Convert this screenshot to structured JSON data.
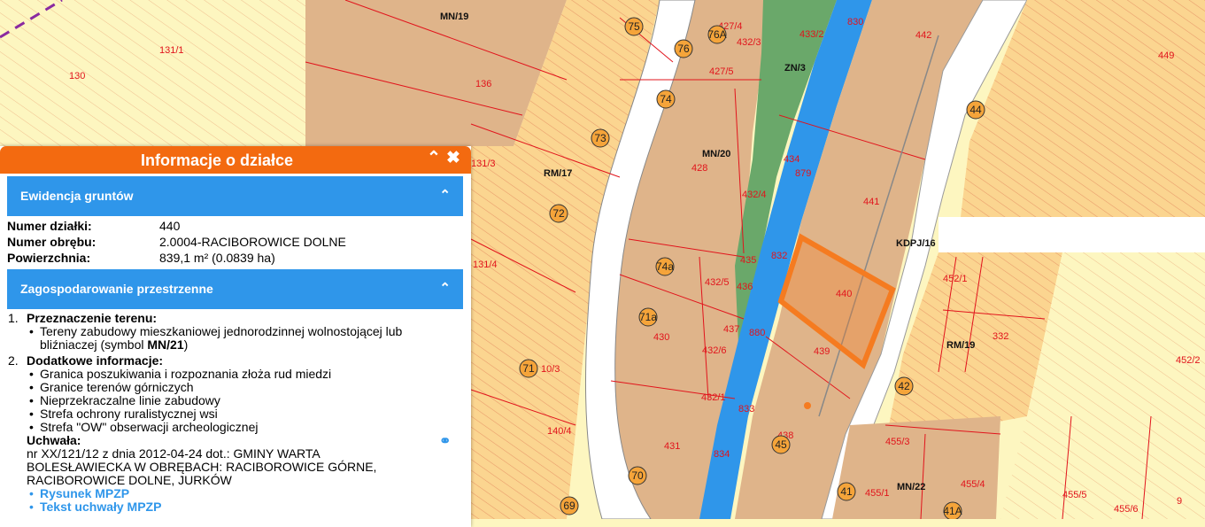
{
  "panel": {
    "title": "Informacje o działce",
    "collapse_icon": "chevron-up-icon",
    "close_icon": "close-icon",
    "sections": {
      "ewidencja": {
        "title": "Ewidencja gruntów",
        "fields": [
          {
            "label": "Numer działki:",
            "value": "440"
          },
          {
            "label": "Numer obrębu:",
            "value": "2.0004-RACIBOROWICE DOLNE"
          },
          {
            "label": "Powierzchnia:",
            "value": "839,1 m² (0.0839 ha)"
          }
        ]
      },
      "zagospodarowanie": {
        "title": "Zagospodarowanie przestrzenne",
        "purpose": {
          "number": "1.",
          "heading": "Przeznaczenie terenu:",
          "line1": "Tereny zabudowy mieszkaniowej jednorodzinnej wolnostojącej lub",
          "line2_pre": "bliźniaczej (symbol ",
          "line2_symbol": "MN/21",
          "line2_post": ")"
        },
        "additional": {
          "number": "2.",
          "heading": "Dodatkowe informacje:",
          "items": [
            "Granica poszukiwania i rozpoznania złoża rud miedzi",
            "Granice terenów górniczych",
            "Nieprzekraczalne linie zabudowy",
            "Strefa ochrony ruralistycznej wsi",
            "Strefa \"OW\" obserwacji archeologicznej"
          ]
        },
        "resolution": {
          "heading": "Uchwała:",
          "lines": [
            "nr XX/121/12 z dnia 2012-04-24 dot.: GMINY WARTA",
            "BOLESŁAWIECKA W OBRĘBACH: RACIBOROWICE GÓRNE,",
            "RACIBOROWICE DOLNE, JURKÓW"
          ],
          "link_icon": "link-icon",
          "links": [
            "Rysunek MPZP",
            "Tekst uchwały MPZP"
          ]
        }
      }
    }
  },
  "map": {
    "colors": {
      "residential": "#dfb48a",
      "agricultural_hatch": "#fbd590",
      "yellow_zone": "#fdf6c0",
      "green": "#6aa86a",
      "water": "#2f96ea",
      "plot_line": "#e1141c",
      "selection": "#f57b20",
      "house_marker": "#f5a43a"
    },
    "zone_labels": [
      "MN/19",
      "ZN/3",
      "MN/20",
      "RM/17",
      "KDPJ/16",
      "RM/19",
      "MN/22"
    ],
    "plot_labels": [
      "131/1",
      "130",
      "136",
      "427/4",
      "432/3",
      "427/5",
      "433/2",
      "830",
      "442",
      "449",
      "131/3",
      "428",
      "434",
      "879",
      "441",
      "432/4",
      "131/4",
      "435",
      "832",
      "432/5",
      "436",
      "440",
      "452/1",
      "430",
      "437",
      "880",
      "439",
      "332",
      "452/2",
      "432/6",
      "10/3",
      "432/1",
      "833",
      "140/4",
      "431",
      "438",
      "455/3",
      "834",
      "455/4",
      "455/1",
      "455/5",
      "455/6",
      "9"
    ],
    "house_numbers": [
      "75",
      "76A",
      "76",
      "74",
      "73",
      "72",
      "74a",
      "71a",
      "71",
      "70",
      "69",
      "45",
      "44",
      "42",
      "41",
      "41A"
    ]
  }
}
